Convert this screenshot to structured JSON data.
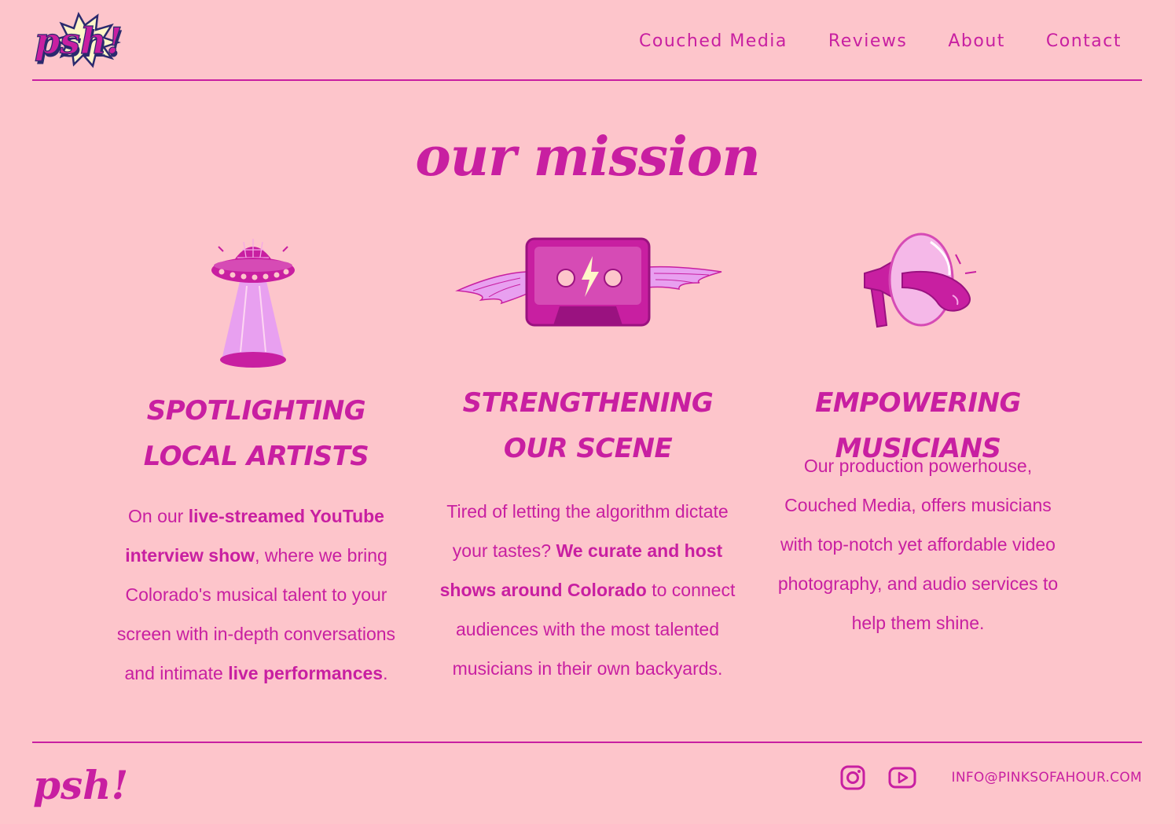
{
  "header": {
    "logo_text": "psh!",
    "nav": [
      {
        "label": "Couched Media"
      },
      {
        "label": "Reviews"
      },
      {
        "label": "About"
      },
      {
        "label": "Contact"
      }
    ]
  },
  "main": {
    "title": "our mission",
    "columns": [
      {
        "icon": "ufo-disco-ball-icon",
        "heading": "SPOTLIGHTING LOCAL ARTISTS",
        "body": {
          "t1": "On our ",
          "b1": "live-streamed YouTube interview show",
          "t2": ", where we bring Colorado's musical talent to your screen with in-depth conversations and intimate ",
          "b2": "live performances",
          "t3": "."
        }
      },
      {
        "icon": "winged-cassette-icon",
        "heading": "STRENGTHENING OUR SCENE",
        "body": {
          "t1": "Tired of letting the algorithm dictate your tastes? ",
          "b1": "We curate and host shows around Colorado",
          "t2": " to connect audiences with the most talented musicians in their own backyards."
        }
      },
      {
        "icon": "megaphone-tongue-icon",
        "heading": "EMPOWERING MUSICIANS",
        "body": {
          "t1": "Our production powerhouse, Couched Media, offers musicians with top-notch yet affordable video photography, and audio services to help them shine."
        }
      }
    ]
  },
  "footer": {
    "logo_text": "psh!",
    "social": [
      {
        "icon": "instagram-icon"
      },
      {
        "icon": "youtube-icon"
      }
    ],
    "email": "INFO@PINKSOFAHOUR.COM"
  },
  "colors": {
    "background": "#fdc5cb",
    "accent": "#c81fa1",
    "accent_light": "#e8a0f0",
    "navy": "#2b2a6e",
    "cream": "#fff6c8"
  }
}
